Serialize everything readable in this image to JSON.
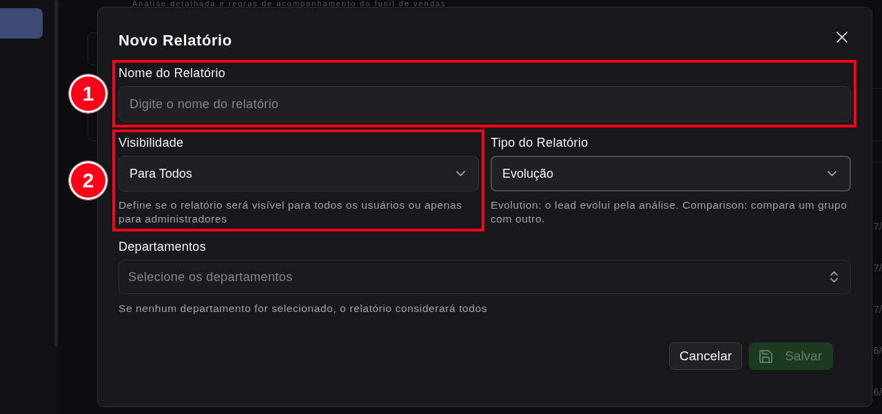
{
  "sidebar": {
    "items": [
      {
        "selected": true
      }
    ]
  },
  "background": {
    "subtitle": "Análise detalhada e regras de acompanhamento do funil de vendas",
    "table_cells": [
      "7/",
      "7/",
      "7/",
      "6/",
      "6/"
    ]
  },
  "dialog": {
    "title": "Novo Relatório",
    "rows": [
      [
        {
          "kind": "text",
          "label": "Nome do Relatório",
          "placeholder": "Digite o nome do relatório",
          "focused": false,
          "annotation": "1"
        }
      ],
      [
        {
          "kind": "select",
          "label": "Visibilidade",
          "value": "Para Todos",
          "hint": "Define se o relatório será visível para todos os usuários ou apenas para administradores",
          "focused": false,
          "annotation": "2"
        },
        {
          "kind": "select",
          "label": "Tipo do Relatório",
          "value": "Evolução",
          "hint": "Evolution: o lead evolui pela análise. Comparison: compara um grupo com outro.",
          "focused": true
        }
      ],
      [
        {
          "kind": "multiselect",
          "label": "Departamentos",
          "placeholder": "Selecione os departamentos",
          "hint": "Se nenhum departamento for selecionado, o relatório considerará todos",
          "focused": false
        }
      ]
    ],
    "buttons": [
      {
        "kind": "secondary",
        "label": "Cancelar",
        "disabled": false
      },
      {
        "kind": "primary",
        "label": "Salvar",
        "disabled": true
      }
    ]
  }
}
